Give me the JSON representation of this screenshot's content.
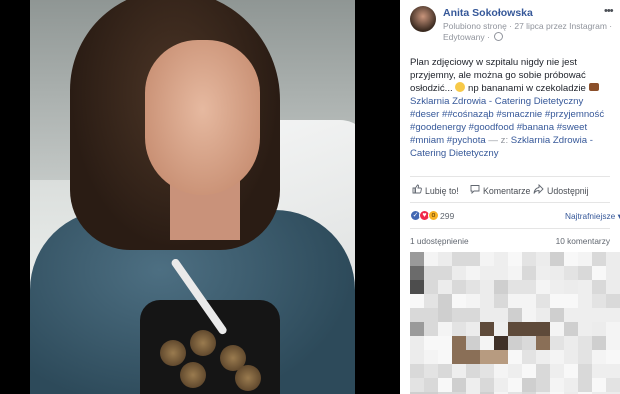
{
  "post": {
    "author": "Anita Sokołowska",
    "meta_line1": "Polubiono stronę · 27 lipca przez Instagram ·",
    "meta_line2": "Edytowany ·",
    "text_plain1": "Plan zdjęciowy w szpitalu nigdy nie jest przyjemny, ale można go sobie próbować osłodzić... ",
    "text_plain2": " np bananami w czekoladzie ",
    "link1": "Szklarnia Zdrowia - Catering Dietetyczny",
    "hashtags": "#deser ##cośnaząb #smacznie #przyjemność #goodenergy #goodfood #banana #sweet #mniam #pychota",
    "with_prefix": " — z: ",
    "link2": "Szklarnia Zdrowia - Catering Dietetyczny"
  },
  "actions": {
    "like": "Lubię to!",
    "comment": "Komentarze",
    "share": "Udostępnij"
  },
  "reactions": {
    "count": "299",
    "sort_label": "Najtrafniejsze ▾",
    "shares": "1 udostępnienie",
    "comments": "10 komentarzy"
  },
  "colors": {
    "link": "#365899",
    "like_blue": "#4267b2",
    "love_red": "#f0284a",
    "wow_yellow": "#f7b125"
  },
  "icons": {
    "more": "more-horizontal-icon",
    "globe": "globe-icon",
    "like": "thumbs-up-icon",
    "comment": "comment-bubble-icon",
    "share": "share-arrow-icon"
  }
}
